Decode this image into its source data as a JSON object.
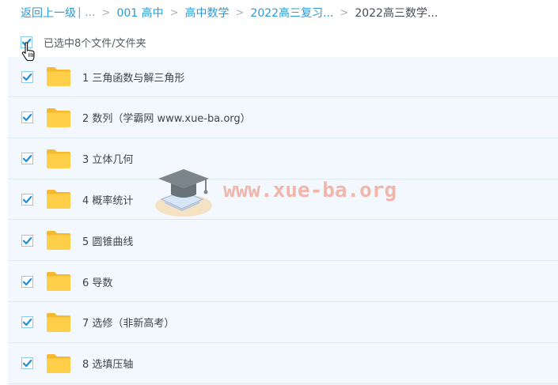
{
  "breadcrumb": {
    "back_label": "返回上一级",
    "more": "| ...",
    "items": [
      "001 高中",
      "高中数学",
      "2022高三复习..."
    ],
    "current": "2022高三数学..."
  },
  "selection": {
    "text": "已选中8个文件/文件夹",
    "checked": true
  },
  "files": [
    {
      "name": "1 三角函数与解三角形",
      "type": "folder",
      "checked": true
    },
    {
      "name": "2 数列（学霸网 www.xue-ba.org）",
      "type": "folder",
      "checked": true
    },
    {
      "name": "3 立体几何",
      "type": "folder",
      "checked": true
    },
    {
      "name": "4 概率统计",
      "type": "folder",
      "checked": true
    },
    {
      "name": "5 圆锥曲线",
      "type": "folder",
      "checked": true
    },
    {
      "name": "6 导数",
      "type": "folder",
      "checked": true
    },
    {
      "name": "7 选修（非新高考）",
      "type": "folder",
      "checked": true
    },
    {
      "name": "8 选填压轴",
      "type": "folder",
      "checked": true
    }
  ],
  "watermark": {
    "text": "www.xue-ba.org",
    "icon": "graduation-cap-book-icon"
  },
  "colors": {
    "link": "#2a9ad6",
    "checkbox_check": "#1f8fd8",
    "folder": "#ffc93d",
    "list_background": "#f2f8fd",
    "watermark": "#f0a090"
  }
}
